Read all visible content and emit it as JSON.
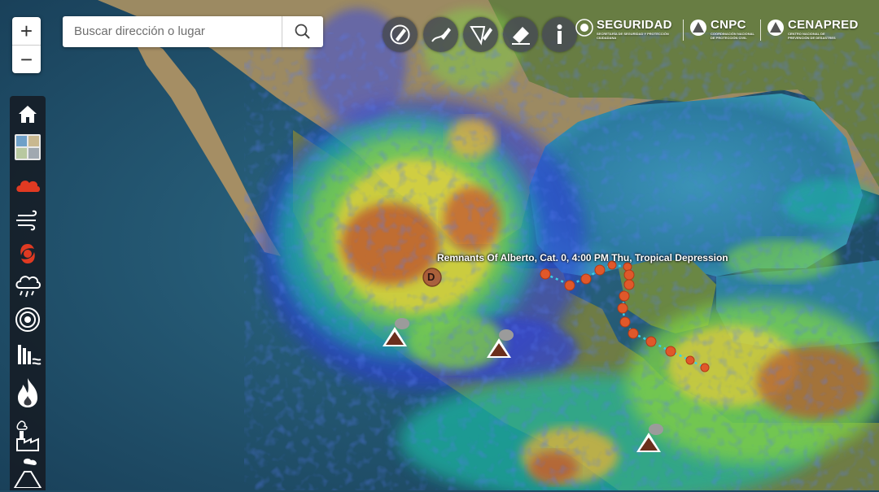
{
  "map": {
    "zoom_in_label": "+",
    "zoom_out_label": "−"
  },
  "search": {
    "placeholder": "Buscar dirección o lugar"
  },
  "toolbar": {
    "tools": [
      "draw-point-icon",
      "draw-line-icon",
      "draw-polygon-icon",
      "erase-icon",
      "info-icon"
    ]
  },
  "logos": {
    "seguridad": {
      "title": "SEGURIDAD",
      "subtitle": "SECRETARÍA DE SEGURIDAD Y PROTECCIÓN CIUDADANA"
    },
    "cnpc": {
      "title": "CNPC",
      "subtitle": "COORDINACIÓN NACIONAL DE PROTECCIÓN CIVIL"
    },
    "cenapred": {
      "title": "CENAPRED",
      "subtitle": "CENTRO NACIONAL DE PREVENCIÓN DE DESASTRES"
    }
  },
  "sidebar": {
    "items": [
      "home-icon",
      "basemap-icon",
      "cloud-icon",
      "wind-icon",
      "hurricane-icon",
      "rain-icon",
      "earthquake-icon",
      "dam-icon",
      "fire-icon",
      "industry-icon",
      "volcano-icon"
    ]
  },
  "storm": {
    "label": "Remnants Of Alberto, Cat. 0, 4:00 PM Thu, Tropical Depression",
    "marker": "D"
  },
  "colors": {
    "ocean": "#1f4a63",
    "track": "#e0582a",
    "sidebar_bg": "#14161c",
    "hurricane_icon": "#e03a22"
  }
}
